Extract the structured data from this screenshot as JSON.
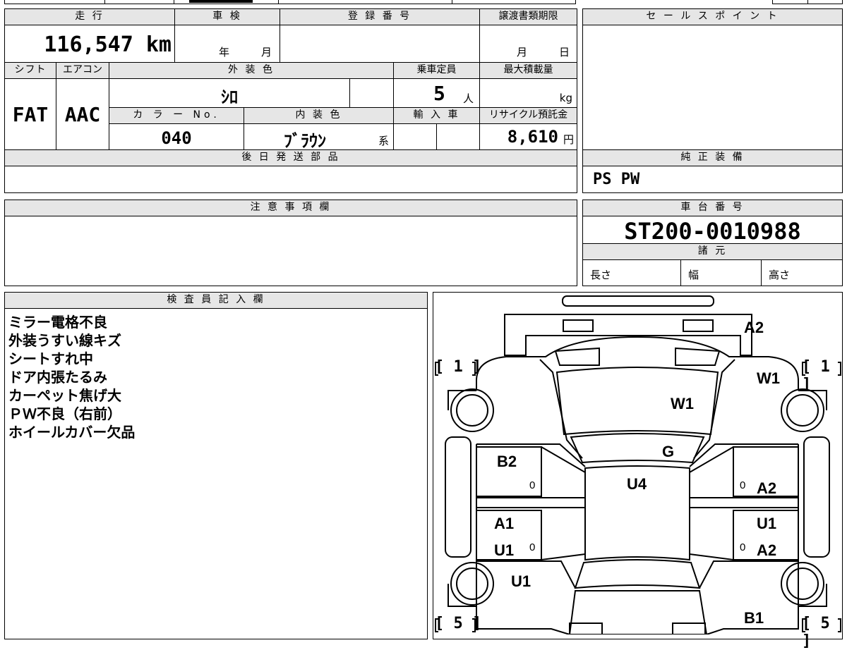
{
  "mileage": {
    "label": "走 行",
    "value": "116,547 km"
  },
  "shaken": {
    "label": "車 検",
    "year_unit": "年",
    "month_unit": "月"
  },
  "registration": {
    "label": "登 録 番 号"
  },
  "transfer_deadline": {
    "label": "譲渡書類期限",
    "month_unit": "月",
    "day_unit": "日"
  },
  "sales_point": {
    "label": "セ ー ル ス ポ イ ン ト"
  },
  "shift": {
    "label": "シフト",
    "value": "FAT"
  },
  "aircon": {
    "label": "エアコン",
    "value": "AAC"
  },
  "exterior_color": {
    "label": "外 装 色",
    "value": "ｼﾛ"
  },
  "capacity": {
    "label": "乗車定員",
    "value": "5",
    "unit": "人"
  },
  "max_load": {
    "label": "最大積載量",
    "unit": "kg"
  },
  "color_no": {
    "label": "カ ラ ー No.",
    "value": "040"
  },
  "interior_color": {
    "label": "内 装 色",
    "value": "ﾌﾞﾗｳﾝ",
    "suffix": "系"
  },
  "import": {
    "label": "輸 入 車"
  },
  "recycle": {
    "label": "リサイクル預託金",
    "value": "8,610",
    "unit": "円"
  },
  "later_parts": {
    "label": "後 日 発 送 部 品"
  },
  "genuine_equipment": {
    "label": "純 正 装 備",
    "value": "PS PW"
  },
  "caution": {
    "label": "注 意 事 項 欄"
  },
  "chassis": {
    "label": "車 台 番 号",
    "value": "ST200-0010988"
  },
  "specs": {
    "label": "諸 元",
    "length": "長さ",
    "width": "幅",
    "height": "高さ"
  },
  "inspector": {
    "label": "検 査 員 記 入 欄",
    "notes": [
      "ミラー電格不良",
      "外装うすい線キズ",
      "シートすれ中",
      "ドア内張たるみ",
      "カーペット焦げ大",
      "ＰＷ不良（右前）",
      "ホイールカバー欠品"
    ]
  },
  "diagram": {
    "tread_top_left": "1",
    "tread_top_right": "1",
    "tread_bottom_left": "5",
    "tread_bottom_right": "5",
    "marks": {
      "rear_a2": "A2",
      "rear_w1": "W1",
      "roof_w1": "W1",
      "g": "G",
      "b2": "B2",
      "u4": "U4",
      "right_a2_front": "A2",
      "a1": "A1",
      "u1_left": "U1",
      "right_u1": "U1",
      "right_a2_rear": "A2",
      "u1_lower": "U1",
      "b1": "B1"
    },
    "zero": "0"
  }
}
